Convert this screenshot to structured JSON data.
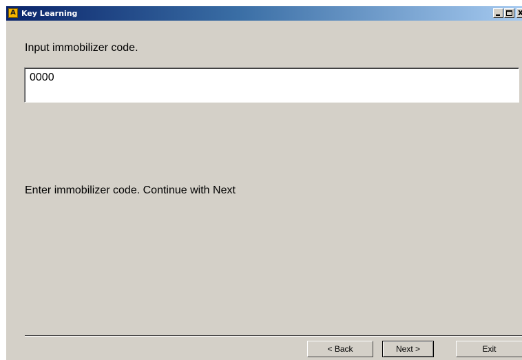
{
  "window": {
    "title": "Key Learning",
    "app_icon_letter": "A",
    "controls": {
      "minimize_icon": "minimize-icon",
      "maximize_icon": "maximize-icon",
      "close_icon": "close-icon",
      "close_glyph": "x"
    }
  },
  "main": {
    "prompt_label": "Input immobilizer code.",
    "code_input_value": "0000",
    "instruction": "Enter immobilizer code. Continue with Next"
  },
  "footer": {
    "back_label": "< Back",
    "next_label": "Next >",
    "exit_label": "Exit"
  },
  "colors": {
    "dialog_background": "#d4d0c8",
    "titlebar_start": "#0a246a",
    "titlebar_end": "#a6caf0",
    "app_icon": "#f5b400"
  }
}
